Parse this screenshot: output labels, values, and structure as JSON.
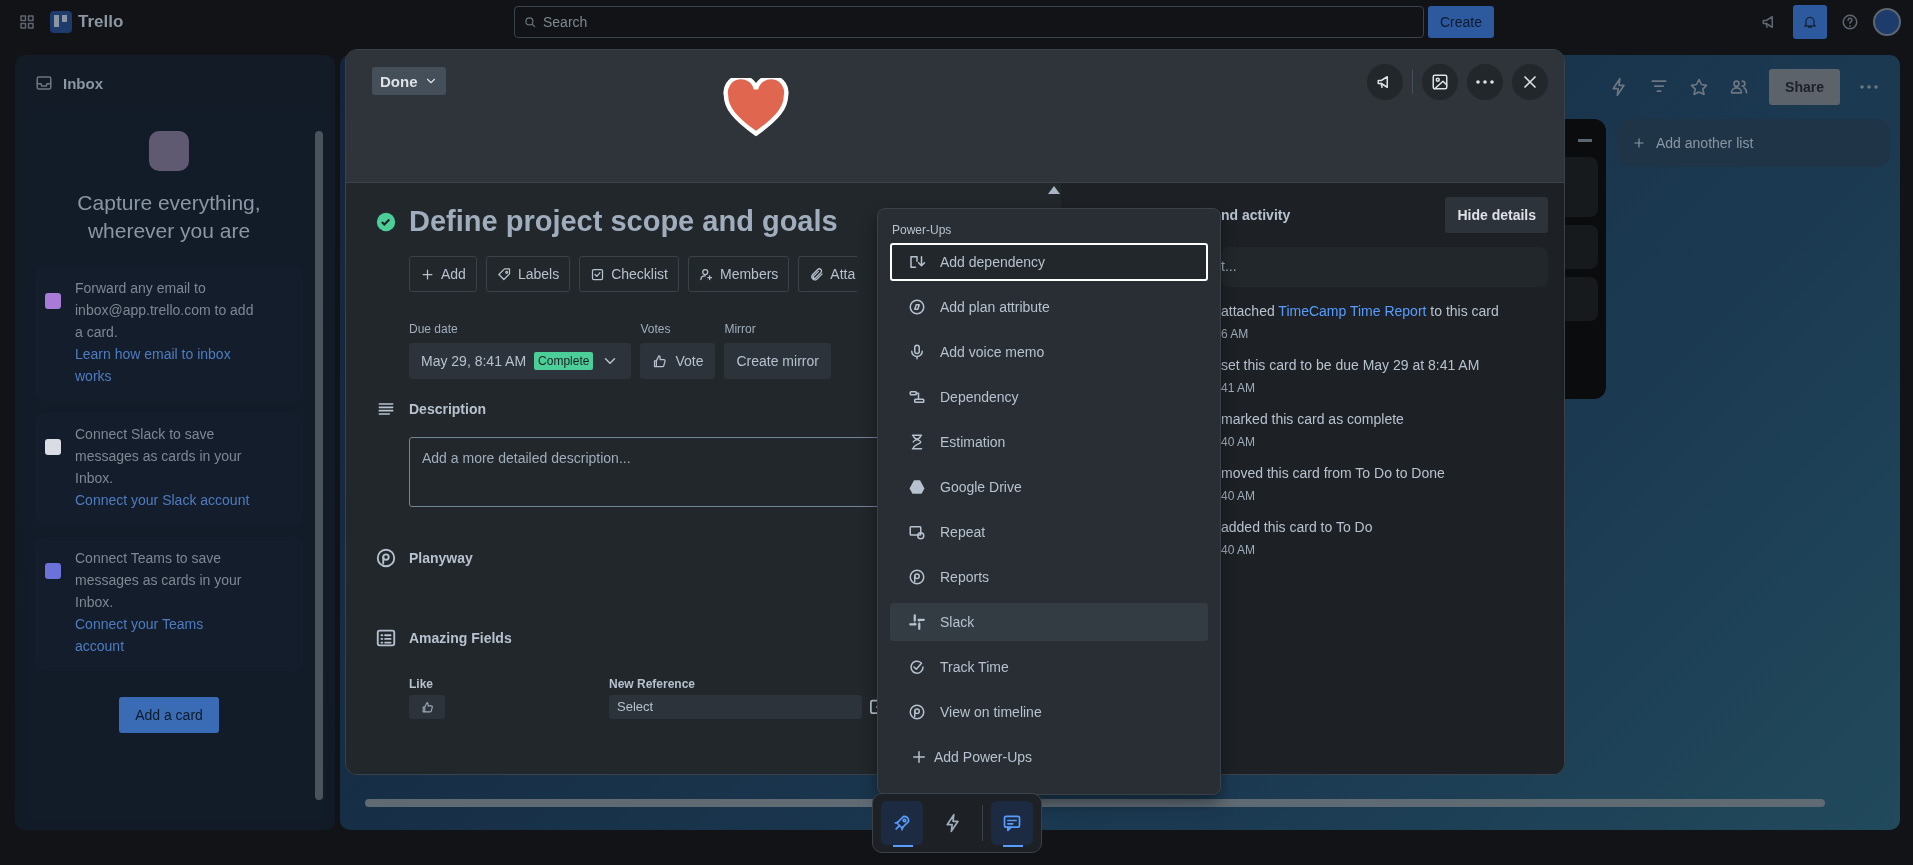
{
  "top_bar": {
    "app_name": "Trello",
    "search": {
      "placeholder": "Search"
    },
    "create_button": "Create"
  },
  "inbox": {
    "title": "Inbox",
    "heading": "Capture everything, wherever you are",
    "sources": [
      {
        "kind": "email",
        "text": "Forward any email to inbox@app.trello.com to add a card.",
        "link": "Learn how email to inbox works"
      },
      {
        "kind": "slack",
        "text": "Connect Slack to save messages as cards in your Inbox.",
        "link": "Connect your Slack account"
      },
      {
        "kind": "teams",
        "text": "Connect Teams to save messages as cards in your Inbox.",
        "link": "Connect your Teams account"
      }
    ],
    "add_card_button": "Add a card"
  },
  "board": {
    "share_button": "Share",
    "add_list": "Add another list"
  },
  "card": {
    "list_button": "Done",
    "title": "Define project scope and goals",
    "complete": true,
    "actions": [
      {
        "kind": "add",
        "label": "Add"
      },
      {
        "kind": "labels",
        "label": "Labels"
      },
      {
        "kind": "checklist",
        "label": "Checklist"
      },
      {
        "kind": "members",
        "label": "Members"
      },
      {
        "kind": "attachment",
        "label": "Atta"
      }
    ],
    "due_date": {
      "label": "Due date",
      "value": "May 29, 8:41 AM",
      "badge": "Complete"
    },
    "votes": {
      "label": "Votes",
      "button": "Vote"
    },
    "mirror": {
      "label": "Mirror",
      "button": "Create mirror"
    },
    "description": {
      "heading": "Description",
      "placeholder": "Add a more detailed description..."
    },
    "planyway": {
      "heading": "Planyway"
    },
    "amazing_fields": {
      "heading": "Amazing Fields",
      "like_label": "Like",
      "reference_label": "New Reference",
      "reference_value": "Select"
    },
    "activity": {
      "heading": "nd activity",
      "hide_details_button": "Hide details",
      "comment_placeholder": "t...",
      "entries": [
        {
          "text": "attached ",
          "link": "TimeCamp Time Report",
          "text_after": " to this card",
          "time": "6 AM"
        },
        {
          "text": "set this card to be due May 29 at 8:41 AM",
          "time": "41 AM"
        },
        {
          "text": "marked this card as complete",
          "time": "40 AM"
        },
        {
          "text": "moved this card from To Do to Done",
          "time": "40 AM"
        },
        {
          "text": "added this card to To Do",
          "time": "40 AM"
        }
      ]
    }
  },
  "power_ups_menu": {
    "title": "Power-Ups",
    "items": [
      {
        "kind": "add-dependency",
        "label": "Add dependency",
        "focused": true,
        "highlighted": false
      },
      {
        "kind": "target",
        "label": "Add plan attribute",
        "focused": false,
        "highlighted": false
      },
      {
        "kind": "mic",
        "label": "Add voice memo",
        "focused": false,
        "highlighted": false
      },
      {
        "kind": "dependency",
        "label": "Dependency",
        "focused": false,
        "highlighted": false
      },
      {
        "kind": "hourglass",
        "label": "Estimation",
        "focused": false,
        "highlighted": false
      },
      {
        "kind": "drive",
        "label": "Google Drive",
        "focused": false,
        "highlighted": false
      },
      {
        "kind": "repeat",
        "label": "Repeat",
        "focused": false,
        "highlighted": false
      },
      {
        "kind": "planyway",
        "label": "Reports",
        "focused": false,
        "highlighted": false
      },
      {
        "kind": "slack",
        "label": "Slack",
        "focused": false,
        "highlighted": true
      },
      {
        "kind": "timer",
        "label": "Track Time",
        "focused": false,
        "highlighted": false
      },
      {
        "kind": "planyway",
        "label": "View on timeline",
        "focused": false,
        "highlighted": false
      },
      {
        "kind": "add",
        "label": "Add Power-Ups",
        "focused": false,
        "highlighted": false
      }
    ]
  },
  "bottom_bar": {
    "buttons": [
      {
        "kind": "power-ups",
        "active": true
      },
      {
        "kind": "automation",
        "active": false
      },
      {
        "kind": "comments",
        "active": true
      }
    ]
  }
}
